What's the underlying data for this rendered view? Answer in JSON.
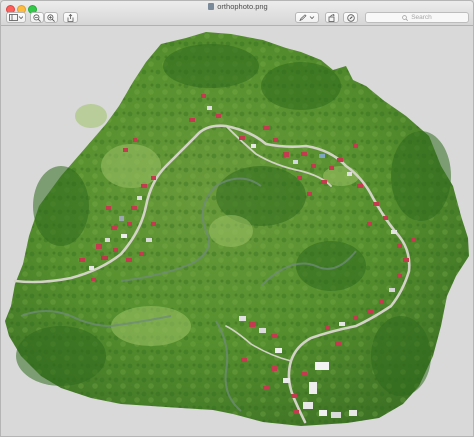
{
  "window": {
    "title": "orthophoto.png",
    "title_icon": "image-file-icon"
  },
  "toolbar": {
    "sidebar_button_icon": "sidebar-toggle-icon",
    "zoom_out_icon": "zoom-out-icon",
    "zoom_in_icon": "zoom-in-icon",
    "share_icon": "share-icon",
    "markup_icon": "markup-pen-icon",
    "rotate_icon": "rotate-icon",
    "annotate_icon": "annotate-circle-icon"
  },
  "search": {
    "placeholder": "Search"
  },
  "colors": {
    "background": "#d9d9d9",
    "vegetation": "#4f8a2a",
    "roofs": "#c23b4e",
    "road": "#cfcfc4"
  }
}
